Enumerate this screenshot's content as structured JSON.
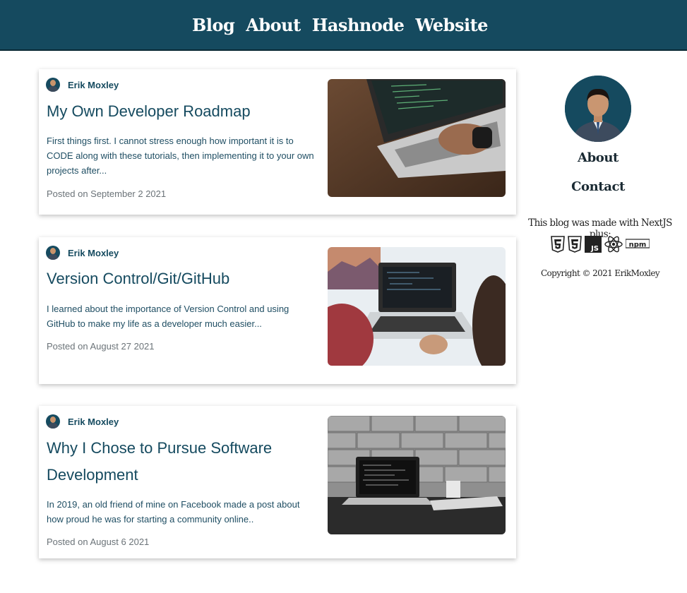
{
  "nav": {
    "items": [
      "Blog",
      "About",
      "Hashnode",
      "Website"
    ]
  },
  "posts": [
    {
      "author": "Erik Moxley",
      "title": "My Own Developer Roadmap",
      "excerpt": "First things first. I cannot stress enough how important it is to CODE along with these tutorials, then implementing it to your own projects after...",
      "date": "Posted on September 2 2021",
      "image": "laptop-typing-photo"
    },
    {
      "author": "Erik Moxley",
      "title": "Version Control/Git/GitHub",
      "excerpt": "I learned about the importance of Version Control and using GitHub to make my life as a developer much easier...",
      "date": "Posted on August 27 2021",
      "image": "laptop-desk-photo"
    },
    {
      "author": "Erik Moxley",
      "title": "Why I Chose to Pursue Software Development",
      "excerpt": "In 2019, an old friend of mine on Facebook made a post about how proud he was for starting a community online..",
      "date": "Posted on August 6 2021",
      "image": "laptop-brick-wall-photo"
    }
  ],
  "sidebar": {
    "about_label": "About",
    "contact_label": "Contact",
    "made_with": "This blog was made with NextJS plus:",
    "tech_icons": [
      "html5-icon",
      "css3-icon",
      "js-icon",
      "react-icon",
      "npm-icon"
    ],
    "js_label": "JS",
    "npm_label": "npm",
    "copyright": "Copyright © 2021 ErikMoxley"
  },
  "colors": {
    "header_bg": "#154a5f",
    "accent_text": "#154a5f",
    "date_text": "#6b7378"
  }
}
